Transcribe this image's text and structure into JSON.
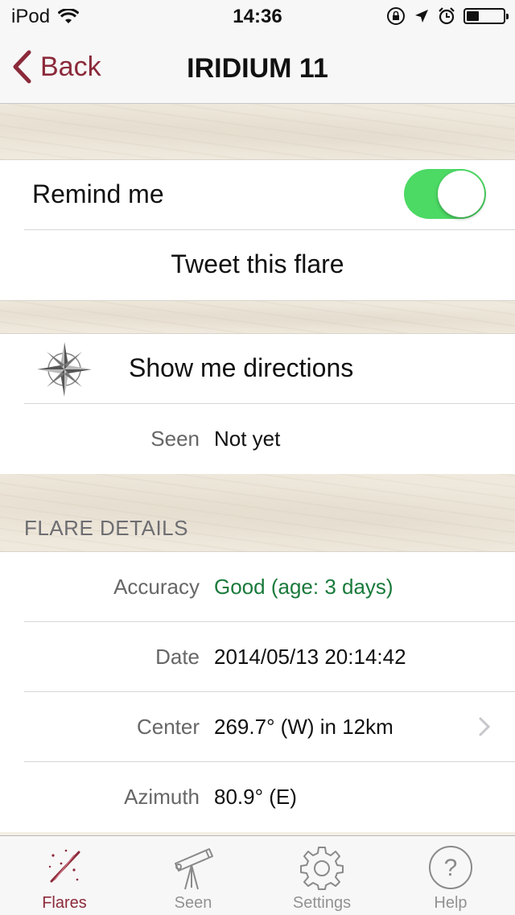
{
  "status_bar": {
    "carrier": "iPod",
    "time": "14:36",
    "battery_level": 0.35
  },
  "nav": {
    "back_label": "Back",
    "title": "IRIDIUM 11"
  },
  "actions": {
    "remind_label": "Remind me",
    "remind_on": true,
    "tweet_label": "Tweet this flare"
  },
  "directions": {
    "label": "Show me directions",
    "seen_key": "Seen",
    "seen_value": "Not yet"
  },
  "details": {
    "header": "FLARE DETAILS",
    "rows": [
      {
        "key": "Accuracy",
        "value": "Good (age: 3 days)"
      },
      {
        "key": "Date",
        "value": "2014/05/13 20:14:42"
      },
      {
        "key": "Center",
        "value": "269.7° (W) in 12km"
      },
      {
        "key": "Azimuth",
        "value": "80.9° (E)"
      }
    ]
  },
  "tabs": [
    {
      "label": "Flares",
      "icon": "flares-icon",
      "active": true
    },
    {
      "label": "Seen",
      "icon": "telescope-icon",
      "active": false
    },
    {
      "label": "Settings",
      "icon": "gear-icon",
      "active": false
    },
    {
      "label": "Help",
      "icon": "help-icon",
      "active": false
    }
  ],
  "colors": {
    "accent": "#8b2a3a",
    "toggle_on": "#4cd964",
    "good": "#1a7a3c"
  }
}
